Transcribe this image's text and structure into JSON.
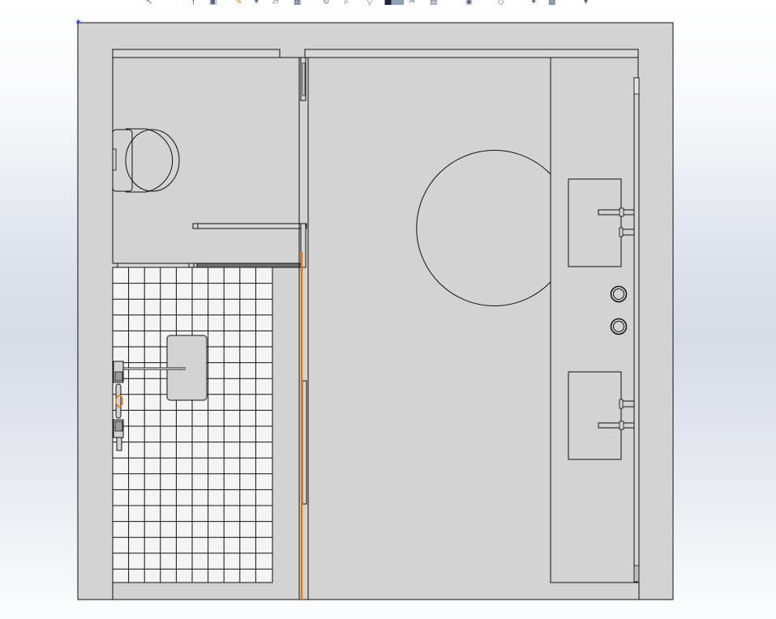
{
  "toolbar": {
    "icons": [
      "cursor-icon",
      "pin-icon",
      "edit-icon",
      "pencil-icon",
      "sketch-icon",
      "plane-icon",
      "camera-icon",
      "rotate-icon",
      "zoom-icon",
      "filter-icon",
      "view-orientation-icon",
      "section-view-icon",
      "display-style-icon",
      "appearance-icon",
      "scene-icon",
      "lights-icon",
      "render-icon",
      "more-icon"
    ]
  },
  "viewport": {
    "background": "#e0e4ec",
    "sheet_color": "#d3d3d3",
    "line_color": "#111111",
    "highlight_color": "#e07a10",
    "origin_color": "#1a33c9"
  },
  "origin": {
    "icon": "origin-triad-icon",
    "glyph": "✶"
  }
}
